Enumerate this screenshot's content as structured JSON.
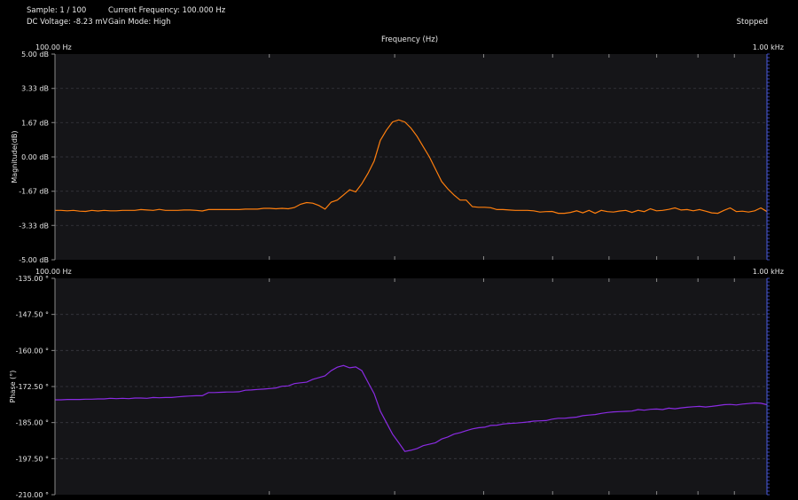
{
  "status": {
    "sample": "Sample: 1 / 100",
    "dc_voltage": "DC Voltage: -8.23 mV",
    "current_frequency": "Current Frequency: 100.000 Hz",
    "gain_mode": "Gain Mode: High",
    "run_state": "Stopped"
  },
  "colors": {
    "background": "#000000",
    "plot_background": "#151518",
    "grid": "#3a3a40",
    "text": "#e6e6e6",
    "magnitude_trace": "#ff7f0e",
    "phase_trace": "#8a2be2",
    "right_ticks": "#4a5be0"
  },
  "chart_data": [
    {
      "type": "line",
      "title": "Frequency (Hz)",
      "xlabel": "Frequency (Hz)",
      "ylabel": "Magnitude(dB)",
      "x_start_label": "100.00 Hz",
      "x_end_label": "1.00 kHz",
      "xlim": [
        100,
        1000
      ],
      "x_scale": "log",
      "ylim": [
        -5.0,
        5.0
      ],
      "y_ticks": [
        5.0,
        3.33,
        1.67,
        0.0,
        -1.67,
        -3.33,
        -5.0
      ],
      "y_tick_labels": [
        "5.00 dB",
        "3.33 dB",
        "1.67 dB",
        "0.00 dB",
        "-1.67 dB",
        "-3.33 dB",
        "-5.00 dB"
      ],
      "grid": true,
      "series": [
        {
          "values": [
            -2.6,
            -2.6,
            -2.62,
            -2.6,
            -2.64,
            -2.65,
            -2.6,
            -2.63,
            -2.6,
            -2.62,
            -2.62,
            -2.6,
            -2.6,
            -2.6,
            -2.56,
            -2.58,
            -2.6,
            -2.55,
            -2.6,
            -2.6,
            -2.6,
            -2.58,
            -2.58,
            -2.6,
            -2.63,
            -2.56,
            -2.56,
            -2.56,
            -2.56,
            -2.56,
            -2.56,
            -2.54,
            -2.54,
            -2.54,
            -2.5,
            -2.5,
            -2.52,
            -2.5,
            -2.52,
            -2.46,
            -2.3,
            -2.22,
            -2.25,
            -2.36,
            -2.54,
            -2.2,
            -2.1,
            -1.85,
            -1.6,
            -1.7,
            -1.3,
            -0.8,
            -0.2,
            0.8,
            1.3,
            1.7,
            1.8,
            1.7,
            1.4,
            1.0,
            0.5,
            0.0,
            -0.6,
            -1.2,
            -1.55,
            -1.85,
            -2.1,
            -2.1,
            -2.42,
            -2.45,
            -2.45,
            -2.47,
            -2.56,
            -2.56,
            -2.58,
            -2.6,
            -2.6,
            -2.6,
            -2.62,
            -2.68,
            -2.66,
            -2.65,
            -2.74,
            -2.74,
            -2.7,
            -2.62,
            -2.72,
            -2.6,
            -2.74,
            -2.6,
            -2.66,
            -2.68,
            -2.63,
            -2.6,
            -2.7,
            -2.6,
            -2.66,
            -2.52,
            -2.62,
            -2.6,
            -2.55,
            -2.48,
            -2.58,
            -2.56,
            -2.62,
            -2.56,
            -2.64,
            -2.72,
            -2.74,
            -2.6,
            -2.48,
            -2.66,
            -2.64,
            -2.68,
            -2.62,
            -2.48,
            -2.66
          ]
        }
      ]
    },
    {
      "type": "line",
      "ylabel": "Phase (°)",
      "x_start_label": "100.00 Hz",
      "x_end_label": "1.00 kHz",
      "xlim": [
        100,
        1000
      ],
      "x_scale": "log",
      "ylim": [
        -210.0,
        -135.0
      ],
      "y_ticks": [
        -135.0,
        -147.5,
        -160.0,
        -172.5,
        -185.0,
        -197.5,
        -210.0
      ],
      "y_tick_labels": [
        "-135.00 °",
        "-147.50 °",
        "-160.00 °",
        "-172.50 °",
        "-185.00 °",
        "-197.50 °",
        "-210.00 °"
      ],
      "grid": true,
      "series": [
        {
          "values": [
            -177.1,
            -177.1,
            -177.0,
            -177.0,
            -177.0,
            -176.9,
            -176.9,
            -176.8,
            -176.8,
            -176.6,
            -176.7,
            -176.6,
            -176.7,
            -176.5,
            -176.5,
            -176.6,
            -176.3,
            -176.4,
            -176.3,
            -176.3,
            -176.1,
            -175.9,
            -175.8,
            -175.7,
            -175.7,
            -174.6,
            -174.6,
            -174.5,
            -174.4,
            -174.4,
            -174.3,
            -173.8,
            -173.7,
            -173.5,
            -173.4,
            -173.2,
            -173.0,
            -172.4,
            -172.3,
            -171.5,
            -171.2,
            -171.0,
            -170.0,
            -169.4,
            -168.8,
            -167.0,
            -165.8,
            -165.2,
            -166.0,
            -165.7,
            -167.0,
            -171.0,
            -175.0,
            -181.0,
            -185.0,
            -189.0,
            -192.0,
            -195.0,
            -194.6,
            -194.0,
            -193.0,
            -192.5,
            -192.0,
            -190.7,
            -190.0,
            -189.0,
            -188.5,
            -187.8,
            -187.2,
            -186.8,
            -186.6,
            -186.0,
            -185.9,
            -185.5,
            -185.3,
            -185.2,
            -185.0,
            -184.8,
            -184.5,
            -184.4,
            -184.3,
            -183.8,
            -183.5,
            -183.5,
            -183.3,
            -183.1,
            -182.6,
            -182.4,
            -182.2,
            -181.8,
            -181.5,
            -181.3,
            -181.2,
            -181.1,
            -181.0,
            -180.5,
            -180.7,
            -180.4,
            -180.3,
            -180.5,
            -180.0,
            -180.2,
            -179.9,
            -179.7,
            -179.5,
            -179.4,
            -179.6,
            -179.4,
            -179.1,
            -178.8,
            -178.7,
            -178.9,
            -178.6,
            -178.4,
            -178.2,
            -178.3,
            -178.8
          ]
        }
      ]
    }
  ]
}
